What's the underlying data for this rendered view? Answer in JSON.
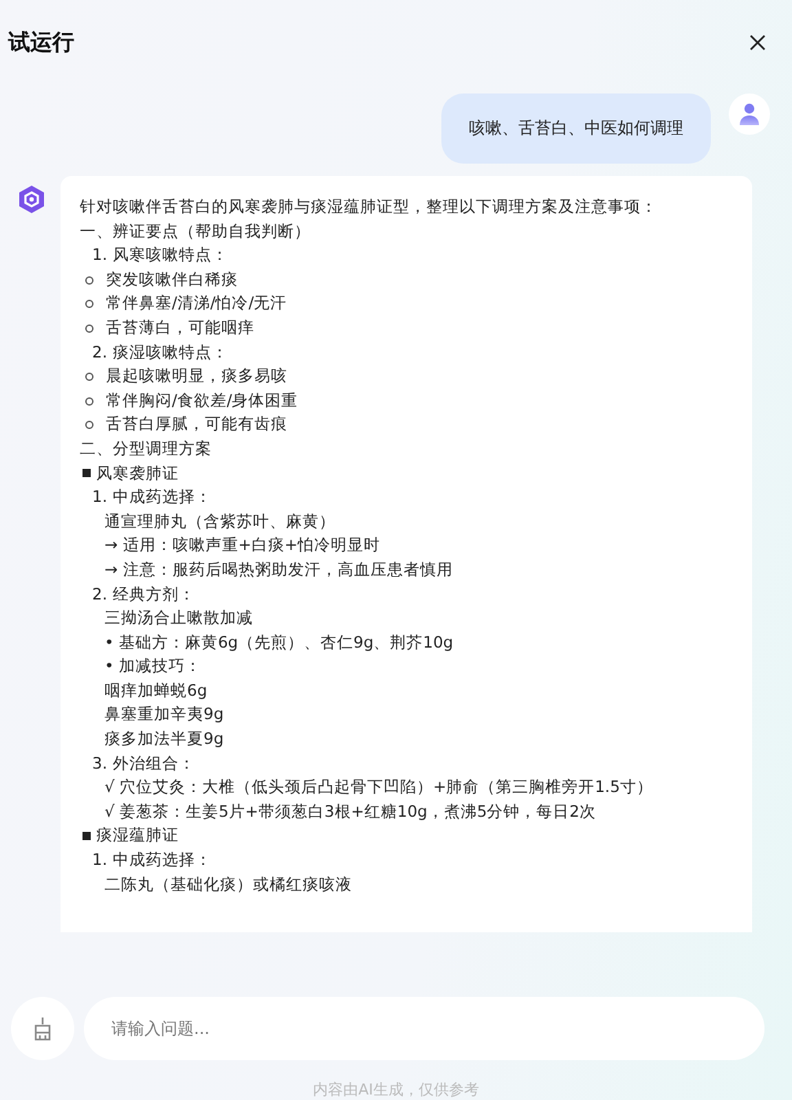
{
  "header": {
    "title": "试运行"
  },
  "user_message": {
    "text": "咳嗽、舌苔白、中医如何调理"
  },
  "answer": {
    "lines": [
      {
        "kind": "para",
        "text": "针对咳嗽伴舌苔白的风寒袭肺与痰湿蕴肺证型，整理以下调理方案及注意事项："
      },
      {
        "kind": "para",
        "text": "一、辨证要点（帮助自我判断）"
      },
      {
        "kind": "numbered",
        "number": "1.",
        "text": "风寒咳嗽特点："
      },
      {
        "kind": "bullet",
        "text": "突发咳嗽伴白稀痰"
      },
      {
        "kind": "bullet",
        "text": "常伴鼻塞/清涕/怕冷/无汗"
      },
      {
        "kind": "bullet",
        "text": "舌苔薄白，可能咽痒"
      },
      {
        "kind": "numbered",
        "number": "2.",
        "text": "痰湿咳嗽特点："
      },
      {
        "kind": "bullet",
        "text": "晨起咳嗽明显，痰多易咳"
      },
      {
        "kind": "bullet",
        "text": "常伴胸闷/食欲差/身体困重"
      },
      {
        "kind": "bullet",
        "text": "舌苔白厚腻，可能有齿痕"
      },
      {
        "kind": "para",
        "text": "二、分型调理方案"
      },
      {
        "kind": "square",
        "text": "风寒袭肺证"
      },
      {
        "kind": "numbered",
        "number": "1.",
        "text": "中成药选择："
      },
      {
        "kind": "indent",
        "text": "通宣理肺丸（含紫苏叶、麻黄）"
      },
      {
        "kind": "indent",
        "text": "→ 适用：咳嗽声重+白痰+怕冷明显时"
      },
      {
        "kind": "indent",
        "text": "→ 注意：服药后喝热粥助发汗，高血压患者慎用"
      },
      {
        "kind": "numbered",
        "number": "2.",
        "text": "经典方剂："
      },
      {
        "kind": "indent",
        "text": "三拗汤合止嗽散加减"
      },
      {
        "kind": "indent",
        "text": "• 基础方：麻黄6g（先煎）、杏仁9g、荆芥10g"
      },
      {
        "kind": "indent",
        "text": "• 加减技巧："
      },
      {
        "kind": "indent",
        "text": "咽痒加蝉蜕6g"
      },
      {
        "kind": "indent",
        "text": "鼻塞重加辛夷9g"
      },
      {
        "kind": "indent",
        "text": "痰多加法半夏9g"
      },
      {
        "kind": "numbered",
        "number": "3.",
        "text": "外治组合："
      },
      {
        "kind": "indent",
        "text": "√ 穴位艾灸：大椎（低头颈后凸起骨下凹陷）+肺俞（第三胸椎旁开1.5寸）"
      },
      {
        "kind": "indent",
        "text": "√ 姜葱茶：生姜5片+带须葱白3根+红糖10g，煮沸5分钟，每日2次"
      },
      {
        "kind": "square",
        "text": "痰湿蕴肺证"
      },
      {
        "kind": "numbered",
        "number": "1.",
        "text": "中成药选择："
      },
      {
        "kind": "indent",
        "text": "二陈丸（基础化痰）或橘红痰咳液"
      }
    ]
  },
  "input": {
    "placeholder": "请输入问题..."
  },
  "footer": {
    "text": "内容由AI生成，仅供参考"
  }
}
